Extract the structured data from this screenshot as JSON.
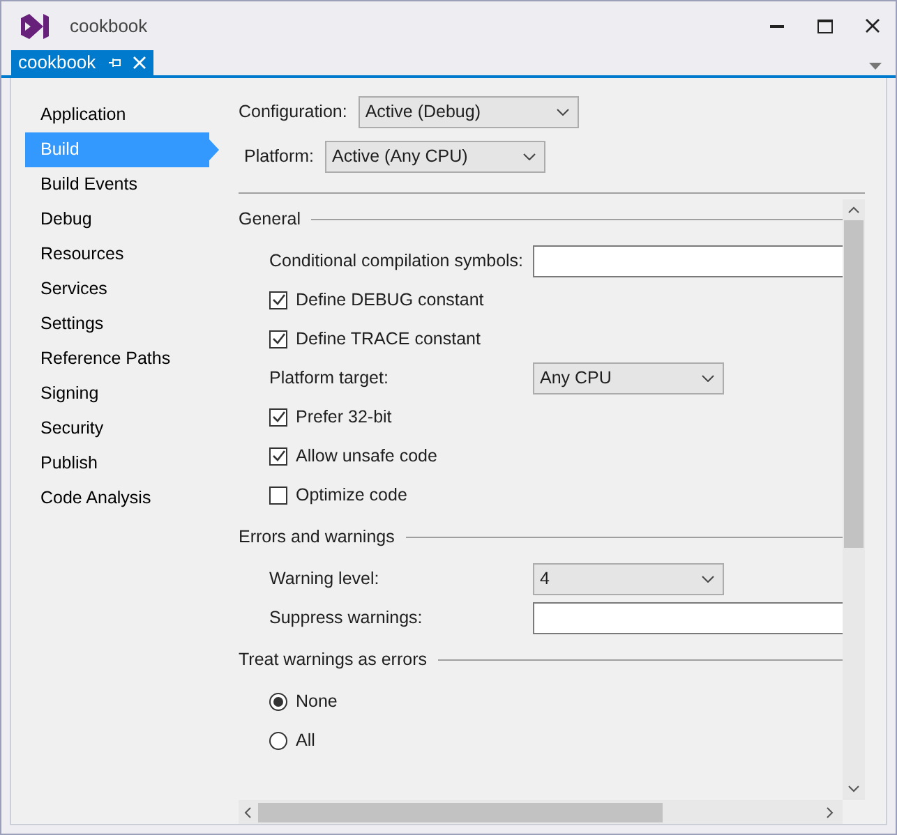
{
  "window": {
    "title": "cookbook"
  },
  "document_tab": {
    "label": "cookbook",
    "selected": true
  },
  "sidebar": {
    "items": [
      {
        "label": "Application",
        "selected": false
      },
      {
        "label": "Build",
        "selected": true
      },
      {
        "label": "Build Events",
        "selected": false
      },
      {
        "label": "Debug",
        "selected": false
      },
      {
        "label": "Resources",
        "selected": false
      },
      {
        "label": "Services",
        "selected": false
      },
      {
        "label": "Settings",
        "selected": false
      },
      {
        "label": "Reference Paths",
        "selected": false
      },
      {
        "label": "Signing",
        "selected": false
      },
      {
        "label": "Security",
        "selected": false
      },
      {
        "label": "Publish",
        "selected": false
      },
      {
        "label": "Code Analysis",
        "selected": false
      }
    ]
  },
  "header": {
    "configuration": {
      "label": "Configuration:",
      "value": "Active (Debug)"
    },
    "platform": {
      "label": "Platform:",
      "value": "Active (Any CPU)"
    }
  },
  "sections": [
    {
      "title": "General",
      "rows": [
        {
          "kind": "text",
          "label": "Conditional compilation symbols:"
        },
        {
          "kind": "checkbox",
          "label": "Define DEBUG constant",
          "checked": true
        },
        {
          "kind": "checkbox",
          "label": "Define TRACE constant",
          "checked": true
        },
        {
          "kind": "select",
          "label": "Platform target:",
          "value": "Any CPU"
        },
        {
          "kind": "checkbox",
          "label": "Prefer 32-bit",
          "checked": true
        },
        {
          "kind": "checkbox",
          "label": "Allow unsafe code",
          "checked": true
        },
        {
          "kind": "checkbox",
          "label": "Optimize code",
          "checked": false
        }
      ]
    },
    {
      "title": "Errors and warnings",
      "rows": [
        {
          "kind": "select",
          "label": "Warning level:",
          "value": "4"
        },
        {
          "kind": "text",
          "label": "Suppress warnings:"
        }
      ]
    },
    {
      "title": "Treat warnings as errors",
      "rows": [
        {
          "kind": "radio",
          "label": "None",
          "selected": true
        },
        {
          "kind": "radio",
          "label": "All",
          "selected": false
        }
      ]
    }
  ]
}
